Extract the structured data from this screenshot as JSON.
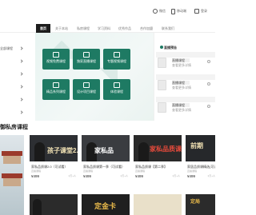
{
  "topbar": {
    "items": [
      {
        "label": "微信"
      },
      {
        "label": "移动端"
      },
      {
        "label": "登录"
      }
    ]
  },
  "nav": {
    "items": [
      {
        "label": "首页"
      },
      {
        "label": "关于本站"
      },
      {
        "label": "私房课程"
      },
      {
        "label": "学习资料"
      },
      {
        "label": "优秀作品"
      },
      {
        "label": "合作加盟"
      },
      {
        "label": "联系我们"
      }
    ]
  },
  "sidebar": {
    "items": [
      {
        "label": "全部课程"
      },
      {
        "label": ""
      },
      {
        "label": ""
      },
      {
        "label": ""
      },
      {
        "label": ""
      },
      {
        "label": ""
      }
    ]
  },
  "banner": {
    "tiles": [
      {
        "label": "视频免费课程"
      },
      {
        "label": "独家直播课程"
      },
      {
        "label": "专题视频课程"
      },
      {
        "label": "精品系列课程"
      },
      {
        "label": "设计项目课程"
      },
      {
        "label": "体验课程"
      }
    ]
  },
  "panel": {
    "title": "直播预告",
    "cards": [
      {
        "name": "直播课程",
        "sub": "查看更多详情"
      },
      {
        "name": "直播课程",
        "sub": "查看更多详情"
      },
      {
        "name": "直播课程",
        "sub": "查看更多详情"
      }
    ]
  },
  "section": {
    "title": "御私房课程"
  },
  "courses": [
    {
      "thumb_text": "孩子课堂2.0",
      "title": "家私品质课2.0（可试看）",
      "sub": "直播课程",
      "price": "¥499",
      "count": "2万+人"
    },
    {
      "thumb_text": "家私品",
      "title": "家私品质课第一季（可试看）",
      "sub": "直播课程",
      "price": "¥499",
      "count": "2万+人"
    },
    {
      "thumb_text": "家私品质课",
      "title": "家私品质课【第二季】",
      "sub": "直播课程",
      "price": "¥499",
      "count": "2万+人"
    },
    {
      "thumb_text": "前期",
      "title": "家居品质课精选(可试看)",
      "sub": "直播课程",
      "price": "¥499",
      "count": "2万+人"
    }
  ],
  "bottom_thumbs": [
    {
      "text": ""
    },
    {
      "text": "定金卡"
    },
    {
      "text": ""
    },
    {
      "text": "定局"
    }
  ],
  "colors": {
    "accent": "#1e7a63",
    "nav_active_bg": "#1d1d1d",
    "card_dark": "#2d2f33",
    "gold": "#e7b84a"
  }
}
